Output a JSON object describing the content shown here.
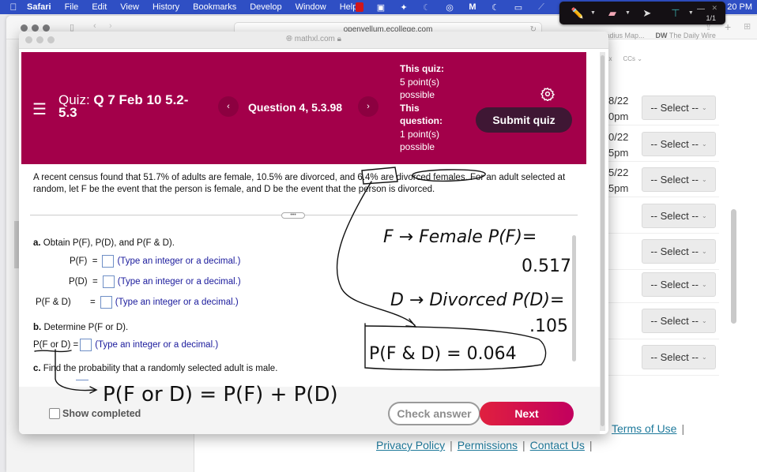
{
  "menubar": {
    "apple_icon": "apple-logo",
    "items": [
      "Safari",
      "File",
      "Edit",
      "View",
      "History",
      "Bookmarks",
      "Develop",
      "Window",
      "Help"
    ],
    "clock": "20 PM"
  },
  "annotation_toolbar": {
    "tools": [
      "pencil-icon",
      "eraser-icon",
      "pointer-icon",
      "highlighter-icon"
    ],
    "pages": "1/1"
  },
  "background_browser": {
    "url": "openvellum.ecollege.com",
    "bookmarks": [
      "Radius Map...",
      "The Daily Wire"
    ],
    "bookmark_badge": "DW",
    "subnav": [
      "Tax",
      "CCs"
    ],
    "rows": [
      {
        "date": "8/22",
        "time": "0pm",
        "select": "-- Select --"
      },
      {
        "date": "0/22",
        "time": "5pm",
        "select": "-- Select --"
      },
      {
        "date": "5/22",
        "time": "5pm",
        "select": "-- Select --"
      },
      {
        "date": "",
        "time": "",
        "select": "-- Select --"
      },
      {
        "date": "",
        "time": "",
        "select": "-- Select --"
      },
      {
        "date": "",
        "time": "",
        "select": "-- Select --"
      },
      {
        "date": "",
        "time": "",
        "select": "-- Select --"
      },
      {
        "date": "",
        "time": "",
        "select": "-- Select --"
      }
    ],
    "footer": {
      "terms": "Terms of Use",
      "privacy": "Privacy Policy",
      "permissions": "Permissions",
      "contact": "Contact Us"
    }
  },
  "modal": {
    "url": "mathxl.com",
    "header": {
      "quiz_label": "Quiz:",
      "quiz_name": "Q 7 Feb 10 5.2-5.3",
      "question_label": "Question 4, 5.3.98",
      "prev": "‹",
      "next": "›",
      "this_quiz_label": "This quiz:",
      "this_quiz_points": "5 point(s) possible",
      "this_question_label": "This question:",
      "this_question_points": "1 point(s) possible",
      "submit": "Submit quiz"
    },
    "question_text": "A recent census found that 51.7% of adults are female, 10.5% are divorced, and 6.4% are divorced females. For an adult selected at random, let F be the event that the person is female, and D be the event that the person is divorced.",
    "part_a": {
      "label": "a.",
      "text": "Obtain P(F), P(D), and P(F & D).",
      "rows": [
        {
          "lhs": "P(F)",
          "eq": "=",
          "value": "",
          "hint": "(Type an integer or a decimal.)"
        },
        {
          "lhs": "P(D)",
          "eq": "=",
          "value": "",
          "hint": "(Type an integer or a decimal.)"
        },
        {
          "lhs": "P(F & D)",
          "eq": "=",
          "value": "",
          "hint": "(Type an integer or a decimal.)"
        }
      ]
    },
    "part_b": {
      "label": "b.",
      "text": "Determine P(F or D).",
      "lhs": "P(F or D) =",
      "value": "",
      "hint": "(Type an integer or a decimal.)"
    },
    "part_c": {
      "label": "c.",
      "text": "Find the probability that a randomly selected adult is male."
    },
    "footer": {
      "show_completed": "Show completed",
      "show_completed_checked": false,
      "check_answer": "Check answer",
      "next": "Next"
    }
  },
  "handwriting": {
    "line1": "F → Female  P(F)=",
    "line2": "0.517",
    "line3": "D → Divorced  P(D)=",
    "line4": ".105",
    "line5": "P(F & D) = 0.064",
    "line6": "P(F or D) = P(F) + P(D)"
  },
  "colors": {
    "brand": "#a3004a",
    "submit": "#3f1734",
    "next_start": "#e0203f",
    "next_end": "#c2005e",
    "hint": "#1a1a9c",
    "link": "#1f7a9c"
  }
}
